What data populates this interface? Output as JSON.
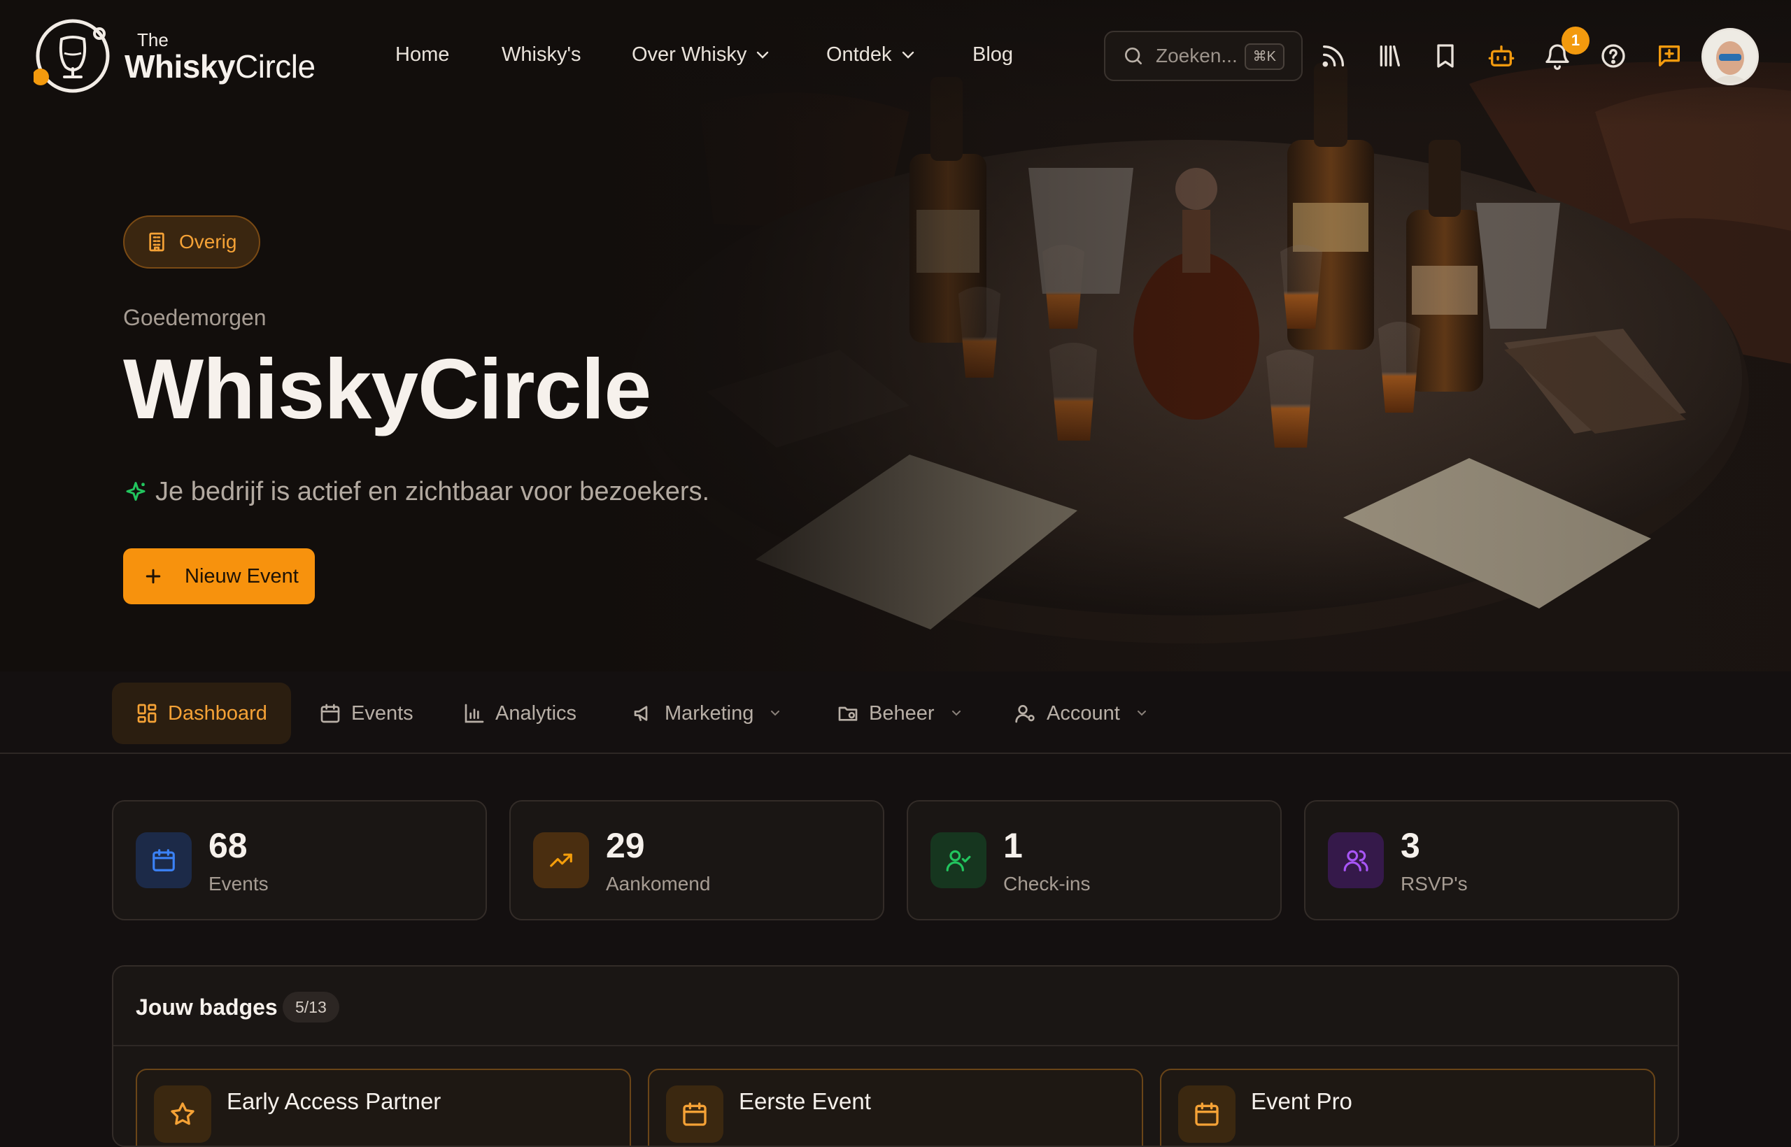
{
  "brand": {
    "the": "The",
    "whisky": "Whisky",
    "circle": "Circle"
  },
  "nav": {
    "home": "Home",
    "whiskys": "Whisky's",
    "over_whisky": "Over Whisky",
    "ontdek": "Ontdek",
    "blog": "Blog"
  },
  "search": {
    "placeholder": "Zoeken...",
    "shortcut": "⌘K"
  },
  "toolbar": {
    "notification_count": "1"
  },
  "hero": {
    "category": "Overig",
    "greeting": "Goedemorgen",
    "title": "WhiskyCircle",
    "status": "Je bedrijf is actief en zichtbaar voor bezoekers.",
    "new_event_label": "Nieuw Event"
  },
  "tabs": {
    "dashboard": "Dashboard",
    "events": "Events",
    "analytics": "Analytics",
    "marketing": "Marketing",
    "beheer": "Beheer",
    "account": "Account"
  },
  "stats": [
    {
      "value": "68",
      "label": "Events",
      "color": "#3b82f6"
    },
    {
      "value": "29",
      "label": "Aankomend",
      "color": "#f59e0b"
    },
    {
      "value": "1",
      "label": "Check-ins",
      "color": "#22c55e"
    },
    {
      "value": "3",
      "label": "RSVP's",
      "color": "#a855f7"
    }
  ],
  "badges": {
    "title": "Jouw badges",
    "count": "5/13",
    "items": [
      {
        "name": "Early Access Partner",
        "icon": "star-icon"
      },
      {
        "name": "Eerste Event",
        "icon": "calendar-icon"
      },
      {
        "name": "Event Pro",
        "icon": "calendar-icon"
      }
    ]
  },
  "colors": {
    "accent": "#f7920d",
    "background": "#141010"
  }
}
